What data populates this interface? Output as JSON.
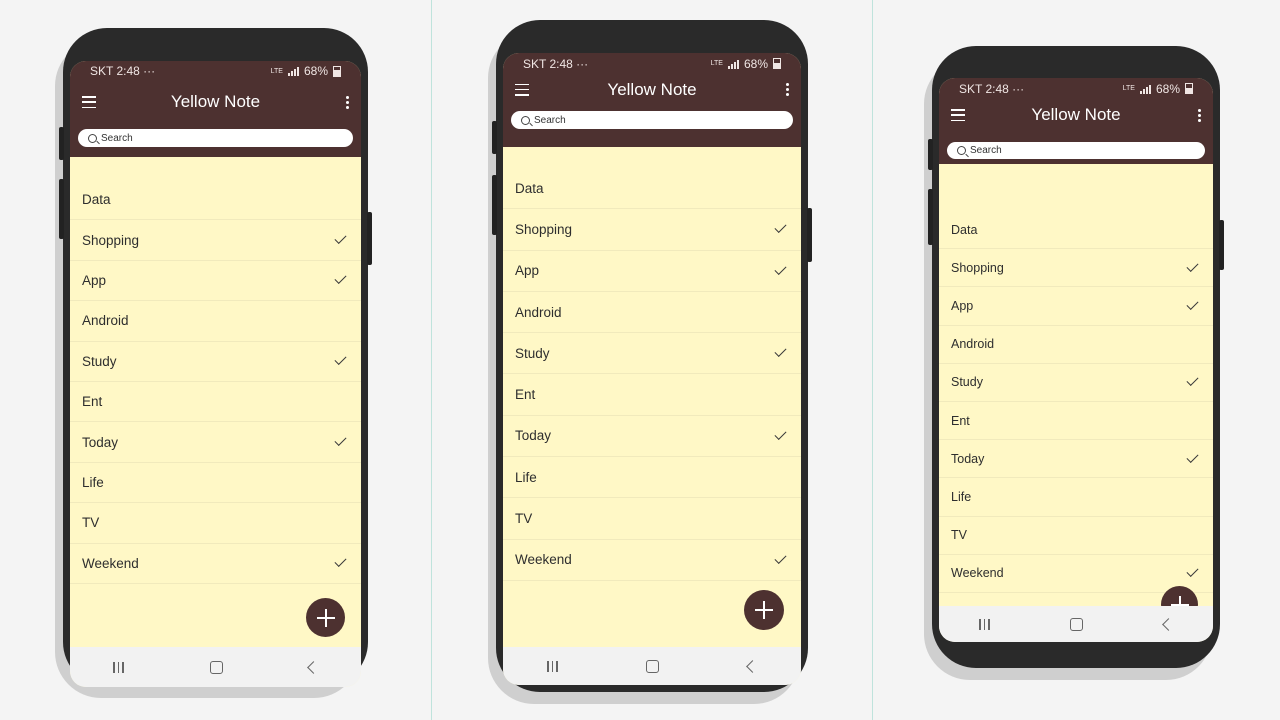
{
  "status_bar": {
    "carrier_time": "SKT 2:48",
    "dots": "···",
    "network": "LTE",
    "battery": "68%"
  },
  "app": {
    "title": "Yellow Note"
  },
  "search": {
    "placeholder": "Search"
  },
  "notes": [
    {
      "label": "Data",
      "checked": false
    },
    {
      "label": "Shopping",
      "checked": true
    },
    {
      "label": "App",
      "checked": true
    },
    {
      "label": "Android",
      "checked": false
    },
    {
      "label": "Study",
      "checked": true
    },
    {
      "label": "Ent",
      "checked": false
    },
    {
      "label": "Today",
      "checked": true
    },
    {
      "label": "Life",
      "checked": false
    },
    {
      "label": "TV",
      "checked": false
    },
    {
      "label": "Weekend",
      "checked": true
    }
  ],
  "icons": {
    "menu": "hamburger-menu-icon",
    "overflow": "more-vert-icon",
    "search": "search-icon",
    "check": "check-icon",
    "fab": "plus-icon",
    "nav_recents": "recents-icon",
    "nav_home": "home-icon",
    "nav_back": "back-icon"
  },
  "colors": {
    "bar": "#4d3130",
    "note_bg": "#fff8c6",
    "page_bg": "#f4f4f4"
  }
}
